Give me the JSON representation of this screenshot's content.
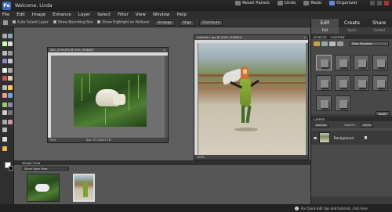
{
  "titlebar": {
    "app_logo": "Pe",
    "welcome": "Welcome, Linda",
    "buttons": [
      {
        "label": "Reset Panels",
        "icon": "reset-panels-icon"
      },
      {
        "label": "Undo",
        "icon": "undo-icon"
      },
      {
        "label": "Redo",
        "icon": "redo-icon"
      },
      {
        "label": "Organizer",
        "icon": "organizer-icon"
      }
    ]
  },
  "menubar": [
    "File",
    "Edit",
    "Image",
    "Enhance",
    "Layer",
    "Select",
    "Filter",
    "View",
    "Window",
    "Help"
  ],
  "options": {
    "auto_select": "Auto Select Layer",
    "bounding_box": "Show Bounding Box",
    "highlight": "Show Highlight on Rollover",
    "arrange": "Arrange",
    "align": "Align",
    "distribute": "Distribute"
  },
  "doc1": {
    "title": "IMG_0709.JPG @ 50% (RGB/8)*",
    "zoom": "50%",
    "info": "Doc: 57.1M/57.1M"
  },
  "doc2": {
    "title": "Untitled-1.jpg @ 100% (RGB/8)*",
    "zoom": "100%"
  },
  "projection": {
    "label": "PROJECTION",
    "dropdown": "Show Open Files"
  },
  "panel": {
    "mode_tabs": [
      "Edit",
      "Create",
      "Share"
    ],
    "sub_tabs": [
      "Full",
      "Quick",
      "Guided"
    ],
    "effects_label": "EFFECTS",
    "effects_sub": "CONTENT",
    "effects_dropdown": "Drop Shadows",
    "apply": "Apply",
    "layers_label": "LAYERS",
    "blend_mode": "Normal",
    "opacity_label": "Opacity:",
    "opacity_value": "100%",
    "layer_name": "Background"
  },
  "status": {
    "hint": "For Quick Edit tips and tutorials, click here."
  }
}
